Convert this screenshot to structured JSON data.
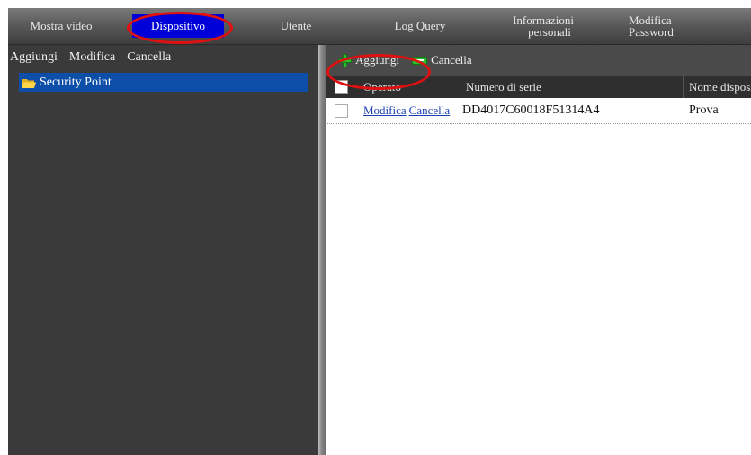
{
  "menu": {
    "items": [
      {
        "label": "Mostra video"
      },
      {
        "label": "Dispositivo",
        "active": true
      },
      {
        "label": "Utente"
      },
      {
        "label": "Log Query"
      },
      {
        "label_line1": "Informazioni",
        "label_line2": "personali"
      },
      {
        "label_line1": "Modifica",
        "label_line2": "Password"
      }
    ]
  },
  "left_toolbar": {
    "add": "Aggiungi",
    "edit": "Modifica",
    "delete": "Cancella"
  },
  "tree": {
    "node_label": "Security Point"
  },
  "right_toolbar": {
    "add": "Aggiungi",
    "delete": "Cancella"
  },
  "grid": {
    "columns": [
      "Operato",
      "Numero di serie",
      "Nome dispositivo"
    ],
    "rows": [
      {
        "edit_link": "Modifica",
        "delete_link": "Cancella",
        "serial": "DD4017C60018F51314A4",
        "name": "Prova"
      }
    ]
  },
  "colors": {
    "active_tab": "#0000d8",
    "highlight": "#e01010",
    "tree_selected": "#0d4fa8",
    "link": "#1a3fb0"
  }
}
